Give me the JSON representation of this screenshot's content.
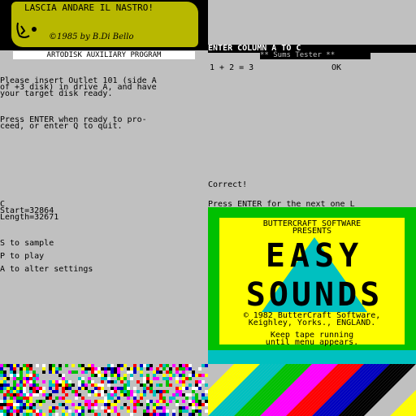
{
  "banner": {
    "title": "LASCIA ANDARE IL NASTRO!",
    "credit": "©1985 by B.Di Bello",
    "subtitle": "ARTODISK AUXILIARY PROGRAM"
  },
  "left": {
    "insert_msg": "Please insert Outlet 101 (side A\nof +3 disk) in drive A, and have\nyour target disk ready.",
    "enter_msg": "Press ENTER when ready to pro-\nceed, or enter Q to quit.",
    "c_line": "C",
    "start_line": "Start=32864",
    "length_line": "Length=32671",
    "menu": [
      "S to sample",
      "P to play",
      "A to alter settings"
    ]
  },
  "right": {
    "enter_column": "ENTER COLUMN A TO C",
    "sums_tester": "** Sums Tester **",
    "sum": "1 + 2 = 3",
    "ok": "OK",
    "correct": "Correct!",
    "next": "Press ENTER for the next one L"
  },
  "buttercraft": {
    "line1": "BUTTERCRAFT SOFTWARE",
    "line2": "PRESENTS",
    "game_title_1": "EASY",
    "game_title_2": "SOUNDS",
    "copyright": "© 1982 ButterCraft Software,\nKeighley, Yorks., ENGLAND.",
    "keep_tape": "Keep tape running\nuntil menu appears.",
    "colors": {
      "border": "#00c000",
      "inner": "#ffff00",
      "cyan": "#00c0c0"
    }
  }
}
